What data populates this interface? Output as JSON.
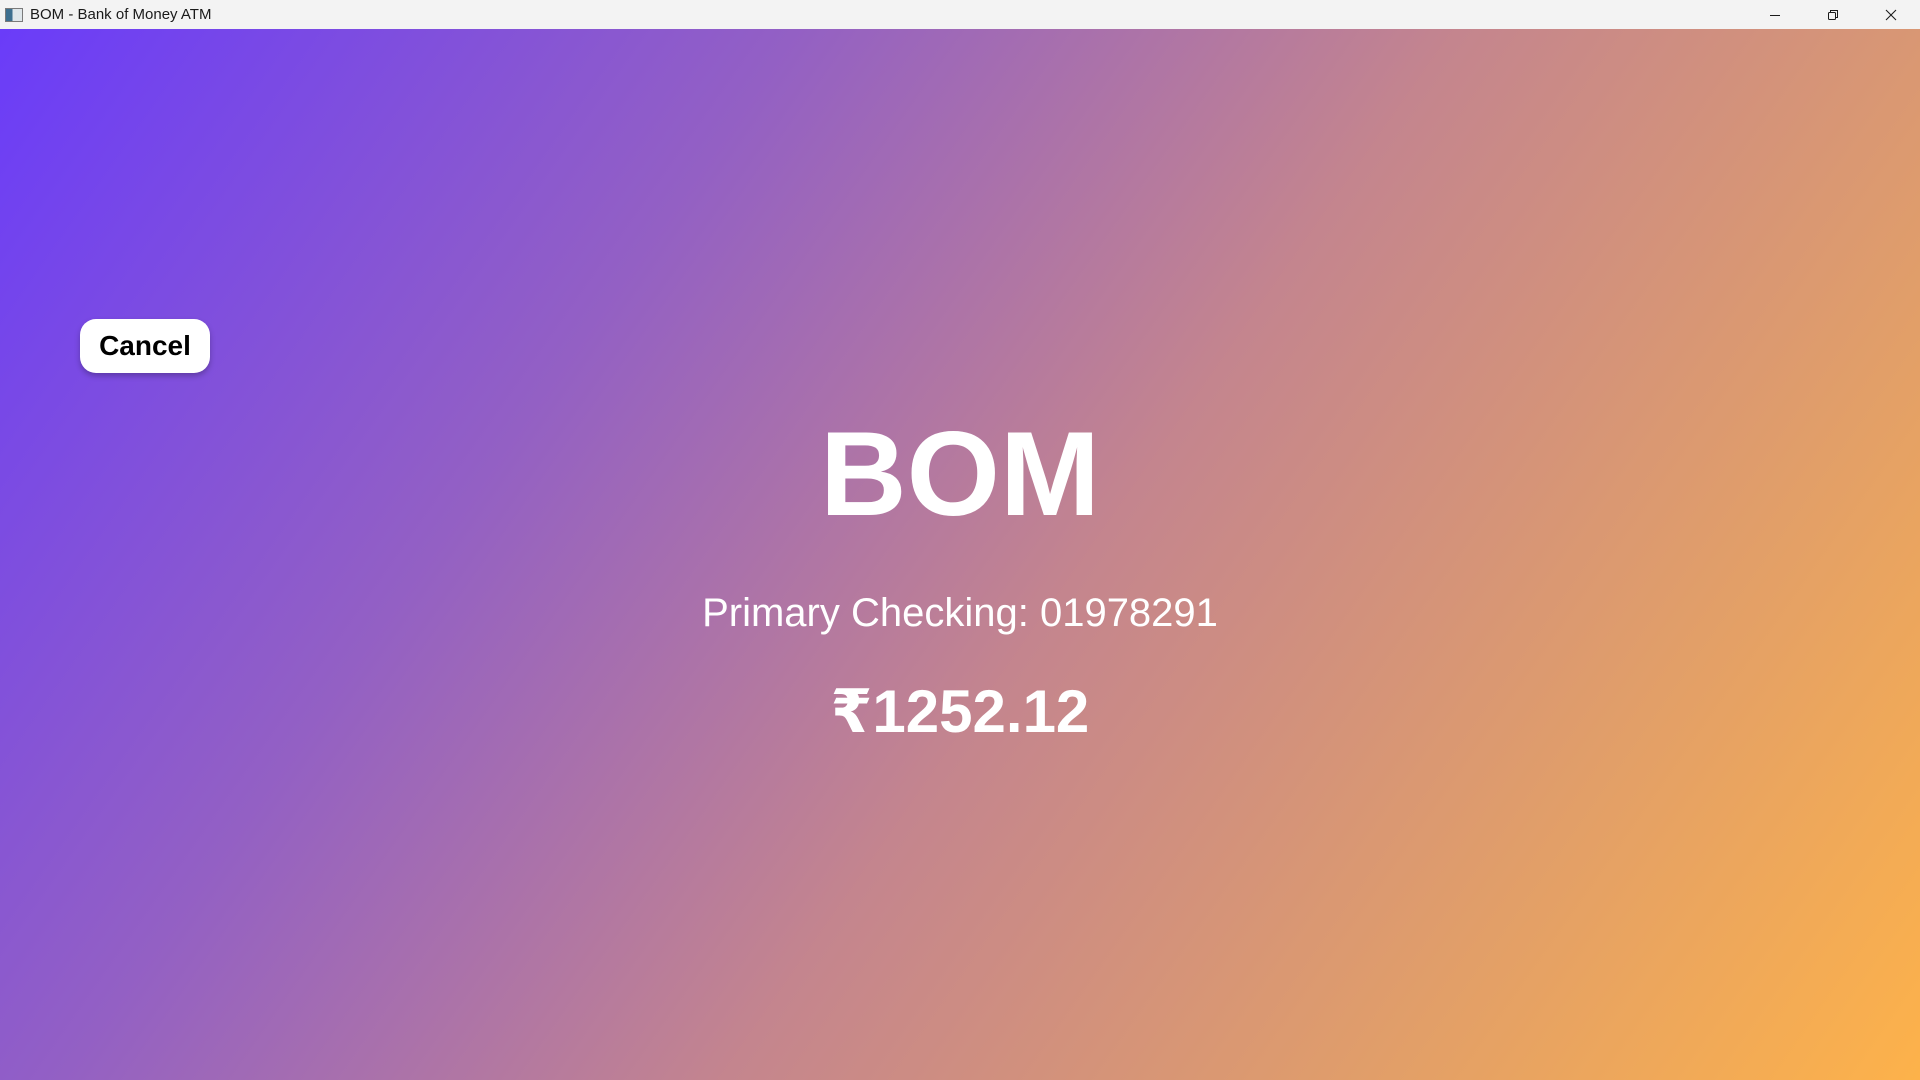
{
  "window": {
    "title": "BOM - Bank of Money ATM",
    "app_icon": "app-window-icon",
    "controls": {
      "minimize_icon": "minimize-icon",
      "restore_icon": "restore-icon",
      "close_icon": "close-icon"
    }
  },
  "screen": {
    "cancel_label": "Cancel",
    "brand": "BOM",
    "account_label": "Primary Checking: 01978291",
    "balance": "₹1252.12"
  },
  "colors": {
    "gradient_start": "#6a3cf9",
    "gradient_end": "#fdb24a",
    "text": "#ffffff",
    "button_bg": "#ffffff"
  }
}
